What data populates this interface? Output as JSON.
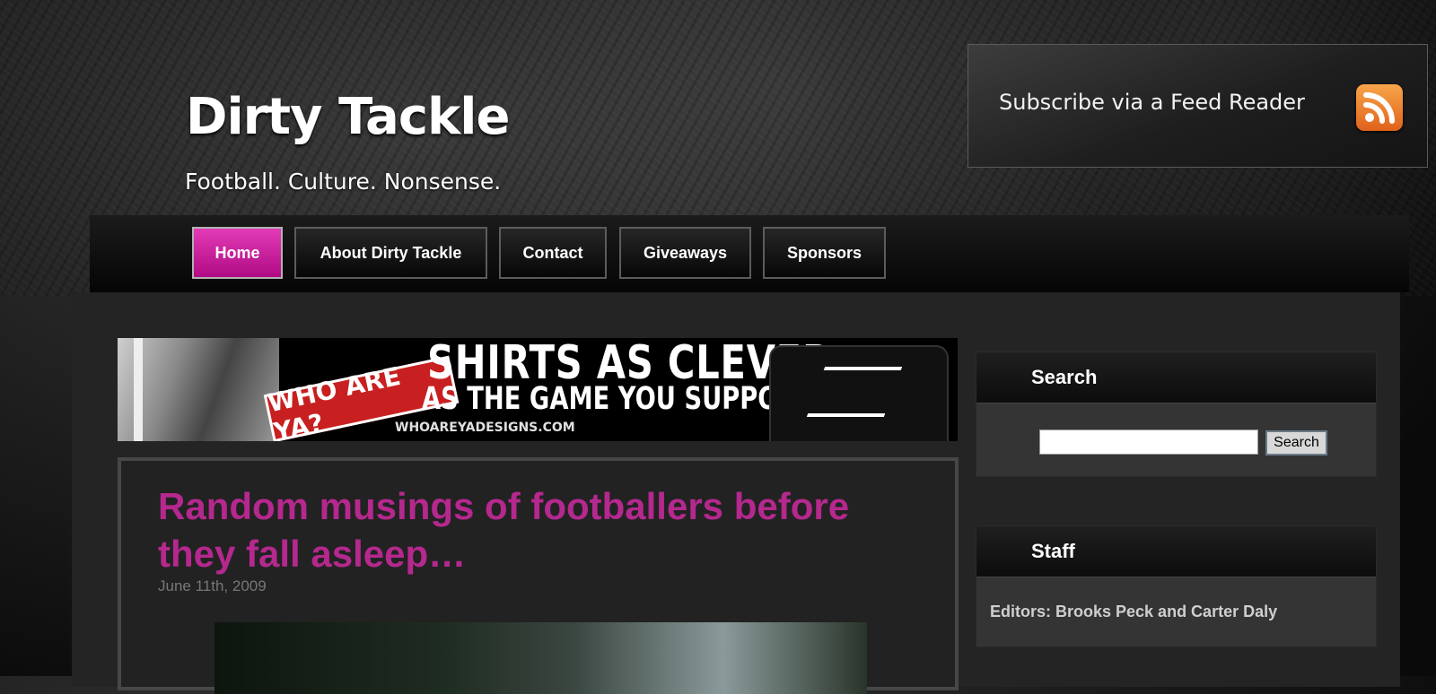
{
  "header": {
    "site_title": "Dirty Tackle",
    "tagline": "Football. Culture. Nonsense.",
    "subscribe_label": "Subscribe via a Feed Reader",
    "subscribe_icon": "rss-icon"
  },
  "nav": {
    "items": [
      {
        "label": "Home",
        "active": true
      },
      {
        "label": "About Dirty Tackle",
        "active": false
      },
      {
        "label": "Contact",
        "active": false
      },
      {
        "label": "Giveaways",
        "active": false
      },
      {
        "label": "Sponsors",
        "active": false
      }
    ],
    "active_color": "#c81a9b"
  },
  "ad": {
    "badge": "WHO ARE YA?",
    "line1": "SHIRTS AS CLEVER",
    "line2": "AS THE GAME YOU SUPPORT",
    "url": "WHOAREYADESIGNS.COM"
  },
  "post": {
    "title": "Random musings of footballers before they fall asleep…",
    "date": "June 11th, 2009",
    "title_color": "#b5288e"
  },
  "sidebar": {
    "search": {
      "title": "Search",
      "input_value": "",
      "button_label": "Search"
    },
    "staff": {
      "title": "Staff",
      "text": "Editors: Brooks Peck and Carter Daly"
    }
  }
}
